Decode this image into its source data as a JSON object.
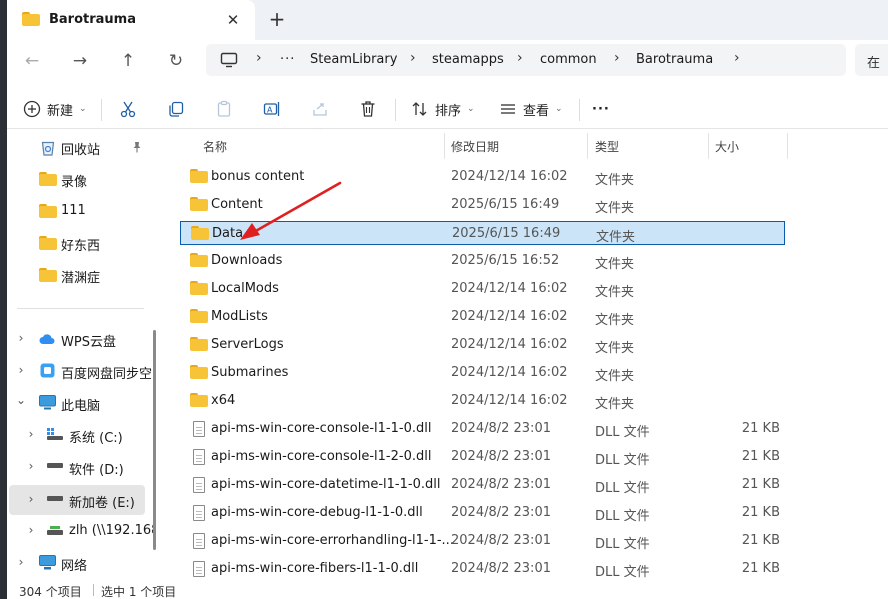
{
  "window": {
    "tab_title": "Barotrauma",
    "tab_close": "✕",
    "tab_new": "+"
  },
  "nav": {
    "back": "←",
    "forward": "→",
    "up": "↑",
    "refresh": "↻",
    "overflow": "···",
    "breadcrumb": [
      "SteamLibrary",
      "steamapps",
      "common",
      "Barotrauma"
    ],
    "search_placeholder": "在"
  },
  "toolbar": {
    "new_label": "新建",
    "sort_label": "排序",
    "view_label": "查看",
    "more": "···"
  },
  "sidebar": {
    "items": [
      {
        "label": "回收站",
        "icon": "recycle-bin-icon",
        "pin": true
      },
      {
        "label": "录像",
        "icon": "folder-icon"
      },
      {
        "label": "111",
        "icon": "folder-icon"
      },
      {
        "label": "好东西",
        "icon": "folder-icon"
      },
      {
        "label": "潜渊症",
        "icon": "folder-icon"
      },
      {
        "label": "WPS云盘",
        "icon": "cloud-icon"
      },
      {
        "label": "百度网盘同步空",
        "icon": "baidu-icon"
      },
      {
        "label": "此电脑",
        "icon": "pc-icon"
      },
      {
        "label": "系统 (C:)",
        "icon": "drive-c-icon"
      },
      {
        "label": "软件 (D:)",
        "icon": "drive-icon"
      },
      {
        "label": "新加卷 (E:)",
        "icon": "drive-icon"
      },
      {
        "label": "zlh (\\\\192.168",
        "icon": "network-drive-icon"
      },
      {
        "label": "网络",
        "icon": "network-icon"
      }
    ]
  },
  "list": {
    "columns": {
      "name": "名称",
      "date": "修改日期",
      "type": "类型",
      "size": "大小"
    },
    "rows": [
      {
        "name": "bonus content",
        "date": "2024/12/14 16:02",
        "type": "文件夹",
        "size": "",
        "kind": "folder"
      },
      {
        "name": "Content",
        "date": "2025/6/15 16:49",
        "type": "文件夹",
        "size": "",
        "kind": "folder"
      },
      {
        "name": "Data",
        "date": "2025/6/15 16:49",
        "type": "文件夹",
        "size": "",
        "kind": "folder",
        "selected": true
      },
      {
        "name": "Downloads",
        "date": "2025/6/15 16:52",
        "type": "文件夹",
        "size": "",
        "kind": "folder"
      },
      {
        "name": "LocalMods",
        "date": "2024/12/14 16:02",
        "type": "文件夹",
        "size": "",
        "kind": "folder"
      },
      {
        "name": "ModLists",
        "date": "2024/12/14 16:02",
        "type": "文件夹",
        "size": "",
        "kind": "folder"
      },
      {
        "name": "ServerLogs",
        "date": "2024/12/14 16:02",
        "type": "文件夹",
        "size": "",
        "kind": "folder"
      },
      {
        "name": "Submarines",
        "date": "2024/12/14 16:02",
        "type": "文件夹",
        "size": "",
        "kind": "folder"
      },
      {
        "name": "x64",
        "date": "2024/12/14 16:02",
        "type": "文件夹",
        "size": "",
        "kind": "folder"
      },
      {
        "name": "api-ms-win-core-console-l1-1-0.dll",
        "date": "2024/8/2 23:01",
        "type": "DLL 文件",
        "size": "21 KB",
        "kind": "file"
      },
      {
        "name": "api-ms-win-core-console-l1-2-0.dll",
        "date": "2024/8/2 23:01",
        "type": "DLL 文件",
        "size": "21 KB",
        "kind": "file"
      },
      {
        "name": "api-ms-win-core-datetime-l1-1-0.dll",
        "date": "2024/8/2 23:01",
        "type": "DLL 文件",
        "size": "21 KB",
        "kind": "file"
      },
      {
        "name": "api-ms-win-core-debug-l1-1-0.dll",
        "date": "2024/8/2 23:01",
        "type": "DLL 文件",
        "size": "21 KB",
        "kind": "file"
      },
      {
        "name": "api-ms-win-core-errorhandling-l1-1-...",
        "date": "2024/8/2 23:01",
        "type": "DLL 文件",
        "size": "21 KB",
        "kind": "file"
      },
      {
        "name": "api-ms-win-core-fibers-l1-1-0.dll",
        "date": "2024/8/2 23:01",
        "type": "DLL 文件",
        "size": "21 KB",
        "kind": "file"
      }
    ]
  },
  "status": {
    "count": "304 个项目",
    "selected": "选中 1 个项目"
  },
  "colors": {
    "selection_bg": "#cce4f7",
    "selection_border": "#0b5cad",
    "folder": "#f8c437",
    "arrow": "#e02020"
  }
}
